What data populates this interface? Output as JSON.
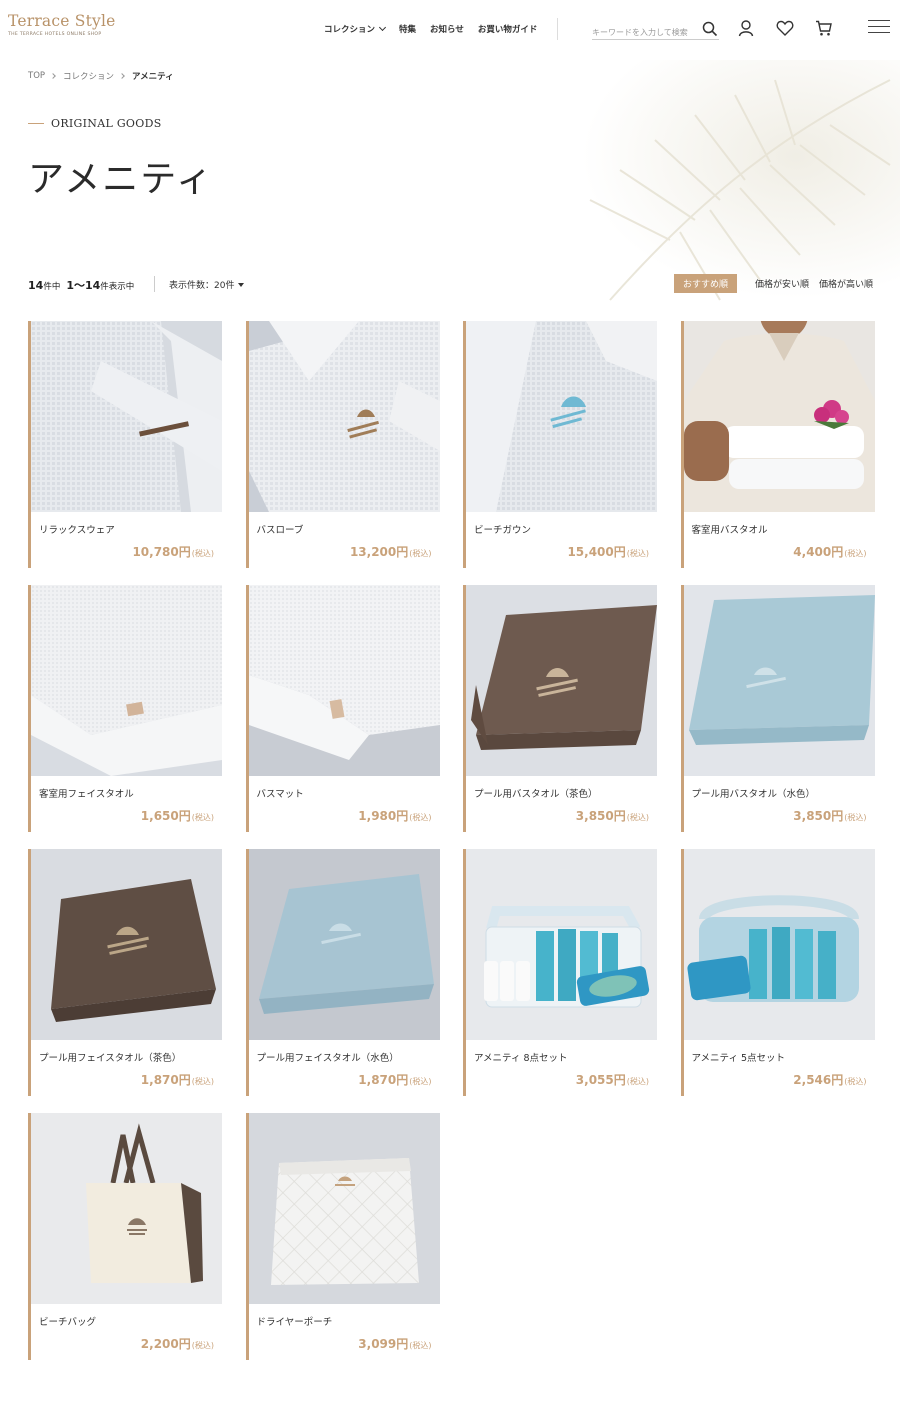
{
  "header": {
    "logo_main": "Terrace Style",
    "logo_sub": "THE TERRACE HOTELS ONLINE SHOP",
    "nav": [
      "コレクション",
      "特集",
      "お知らせ",
      "お買い物ガイド"
    ],
    "search_placeholder": "キーワードを入力して検索"
  },
  "breadcrumb": [
    "TOP",
    "コレクション",
    "アメニティ"
  ],
  "eyebrow": "ORIGINAL GOODS",
  "title": "アメニティ",
  "toolbar": {
    "total": "14",
    "total_suffix": "件中",
    "range": "1〜14",
    "range_suffix": "件表示中",
    "per_page": "表示件数：20件",
    "sorts": [
      "おすすめ順",
      "価格が安い順",
      "価格が高い順"
    ]
  },
  "tax_label": "(税込)",
  "products": [
    {
      "name": "リラックスウェア",
      "price": "10,780円",
      "image": "waffle-robe-detail"
    },
    {
      "name": "バスローブ",
      "price": "13,200円",
      "image": "bathrobe-gold-logo"
    },
    {
      "name": "ビーチガウン",
      "price": "15,400円",
      "image": "beach-gown-blue-logo"
    },
    {
      "name": "客室用バスタオル",
      "price": "4,400円",
      "image": "staff-holding-towels"
    },
    {
      "name": "客室用フェイスタオル",
      "price": "1,650円",
      "image": "white-face-towel"
    },
    {
      "name": "バスマット",
      "price": "1,980円",
      "image": "white-bath-mat"
    },
    {
      "name": "プール用バスタオル（茶色）",
      "price": "3,850円",
      "image": "brown-bath-towel"
    },
    {
      "name": "プール用バスタオル（水色）",
      "price": "3,850円",
      "image": "light-blue-bath-towel"
    },
    {
      "name": "プール用フェイスタオル（茶色）",
      "price": "1,870円",
      "image": "brown-face-towel"
    },
    {
      "name": "プール用フェイスタオル（水色）",
      "price": "1,870円",
      "image": "light-blue-face-towel"
    },
    {
      "name": "アメニティ 8点セット",
      "price": "3,055円",
      "image": "amenity-8-set"
    },
    {
      "name": "アメニティ 5点セット",
      "price": "2,546円",
      "image": "amenity-5-set"
    },
    {
      "name": "ビーチバッグ",
      "price": "2,200円",
      "image": "beach-tote-bag"
    },
    {
      "name": "ドライヤーポーチ",
      "price": "3,099円",
      "image": "quilted-pouch"
    }
  ],
  "colors": {
    "accent": "#c9a27a",
    "logo": "#b89268",
    "text": "#333333"
  }
}
